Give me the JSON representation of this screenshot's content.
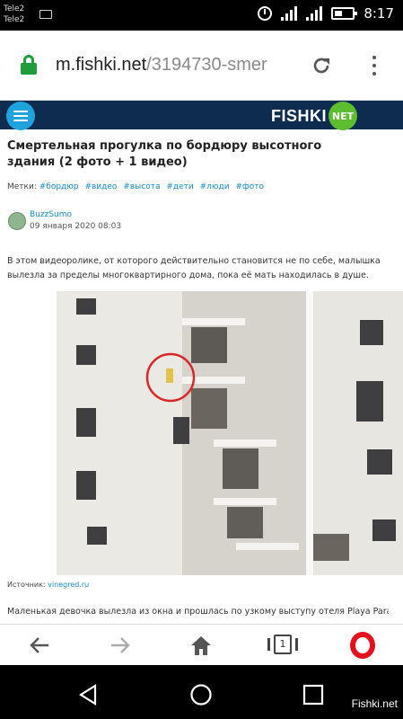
{
  "status_bar": {
    "carrier_1": "Tele2",
    "carrier_2": "Tele2",
    "time": "8:17",
    "icons": [
      "keyboard-icon",
      "alarm-icon",
      "signal-icon",
      "signal-h-icon",
      "battery-icon"
    ]
  },
  "browser": {
    "url_host": "m.fishki.net",
    "url_path": "/3194730-smer",
    "icons": [
      "lock-icon",
      "reload-icon",
      "more-icon"
    ]
  },
  "site": {
    "logo_text": "FISHKI",
    "logo_badge": "NET"
  },
  "article": {
    "title": "Смертельная прогулка по бордюру высотного здания (2 фото + 1 видео)",
    "tags_label": "Метки:",
    "tags": [
      "#бордюр",
      "#видео",
      "#высота",
      "#дети",
      "#люди",
      "#фото"
    ],
    "author": "BuzzSumo",
    "date": "09 января 2020 08:03",
    "paragraph": "В этом видеоролике, от которого действительно становится не по себе, малышка вылезла за пределы многоквартирного дома, пока её мать находилась в душе.",
    "source_label": "Источник:",
    "source_link": "vinegred.ru",
    "paragraph_2": "Маленькая девочка вылезла из окна и прошлась по узкому выступу отеля Playa Paraiso"
  },
  "bottom_bar": {
    "tab_count": "1",
    "icons": [
      "back-icon",
      "forward-icon",
      "home-icon",
      "tabs-icon",
      "opera-icon"
    ]
  },
  "nav_bar": {
    "icons": [
      "nav-back-icon",
      "nav-home-icon",
      "nav-recents-icon"
    ],
    "watermark": "Fishki.net"
  },
  "colors": {
    "header_bg": "#0d2c4f",
    "link": "#1a8ac7",
    "lock": "#1e9e3a",
    "opera": "#e4101e"
  }
}
